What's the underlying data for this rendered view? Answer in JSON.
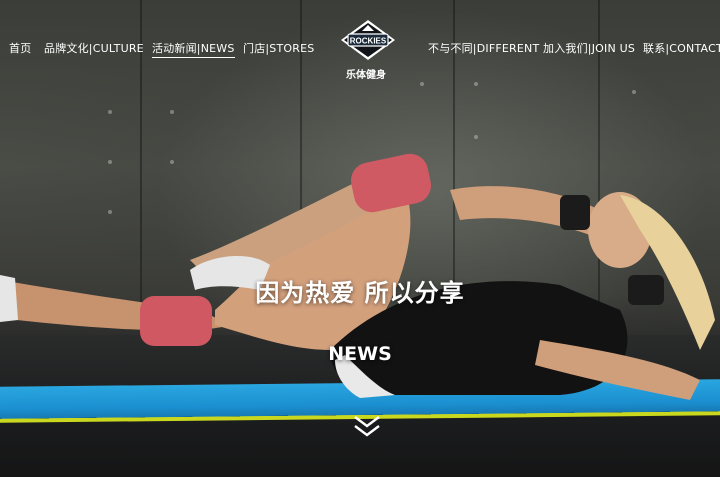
{
  "nav": {
    "home": "首页",
    "culture": "品牌文化|CULTURE",
    "news": "活动新闻|NEWS",
    "stores": "门店|STORES",
    "different": "不与不同|DIFFERENT",
    "join": "加入我们|JOIN US",
    "contact": "联系|CONTACT"
  },
  "logo": {
    "wordmark": "ROCKIES",
    "subtitle": "乐体健身"
  },
  "hero": {
    "headline": "因为热爱 所以分享",
    "subheadline": "NEWS"
  },
  "icons": {
    "scroll": "double-chevron-down-icon"
  },
  "colors": {
    "mat": "#1b8fd0",
    "mat_edge": "#c9d81e",
    "text": "#ffffff"
  }
}
